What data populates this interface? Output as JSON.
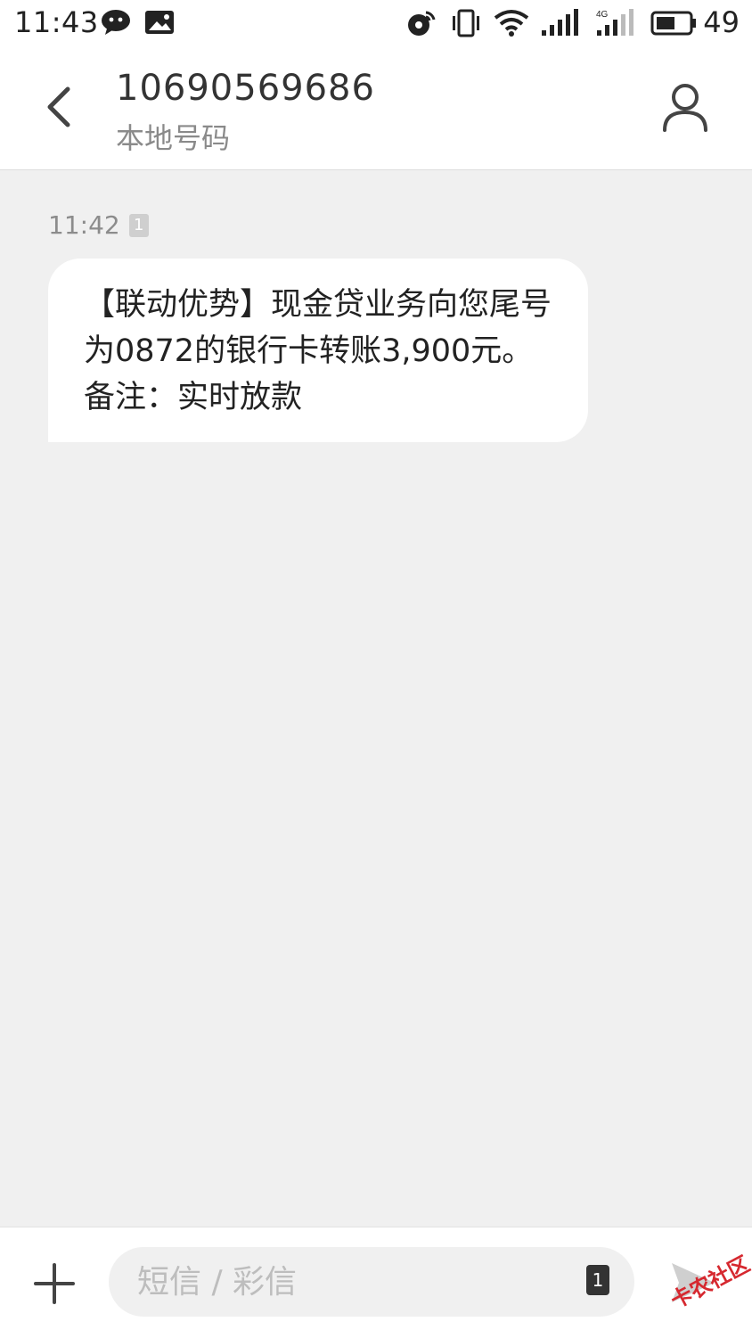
{
  "status_bar": {
    "time": "11:43",
    "battery_level": "49",
    "network_label": "4G",
    "icons": [
      "wechat-icon",
      "image-notification-icon",
      "hotspot-icon",
      "vibrate-icon",
      "wifi-icon",
      "signal-icon",
      "signal-4g-icon",
      "battery-icon"
    ]
  },
  "header": {
    "title": "10690569686",
    "subtitle": "本地号码"
  },
  "messages": [
    {
      "time": "11:42",
      "sim": "1",
      "text": "【联动优势】现金贷业务向您尾号为0872的银行卡转账3,900元。备注：实时放款"
    }
  ],
  "composer": {
    "placeholder": "短信 / 彩信",
    "sim": "1"
  },
  "watermark": "卡农社区",
  "colors": {
    "background": "#f0f0f0",
    "bubble": "#ffffff",
    "text": "#222222",
    "watermark": "#d6282f"
  }
}
